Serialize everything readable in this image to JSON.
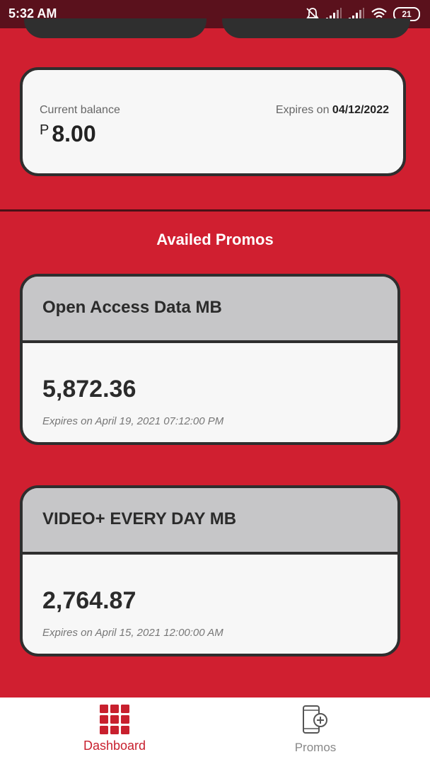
{
  "status_bar": {
    "time": "5:32 AM",
    "battery": "21",
    "icons": [
      "bell-muted-icon",
      "signal-icon",
      "signal-icon",
      "wifi-icon",
      "battery-icon"
    ]
  },
  "balance": {
    "label": "Current balance",
    "currency": "P",
    "amount": "8.00",
    "expires_prefix": "Expires on",
    "expires_date": "04/12/2022"
  },
  "section_title": "Availed Promos",
  "promos": [
    {
      "name": "Open Access Data MB",
      "amount": "5,872.36",
      "expiry": "Expires on April 19, 2021 07:12:00 PM"
    },
    {
      "name": "VIDEO+ EVERY DAY MB",
      "amount": "2,764.87",
      "expiry": "Expires on April 15, 2021 12:00:00 AM"
    }
  ],
  "nav": [
    {
      "label": "Dashboard",
      "icon": "grid-icon",
      "active": true
    },
    {
      "label": "Promos",
      "icon": "phone-plus-icon",
      "active": false
    }
  ],
  "colors": {
    "background": "#d01f30",
    "status_bar": "#5a111c",
    "card": "#f7f7f7",
    "card_header": "#c6c6c8",
    "border": "#2e2e2e",
    "accent": "#c8202e"
  }
}
